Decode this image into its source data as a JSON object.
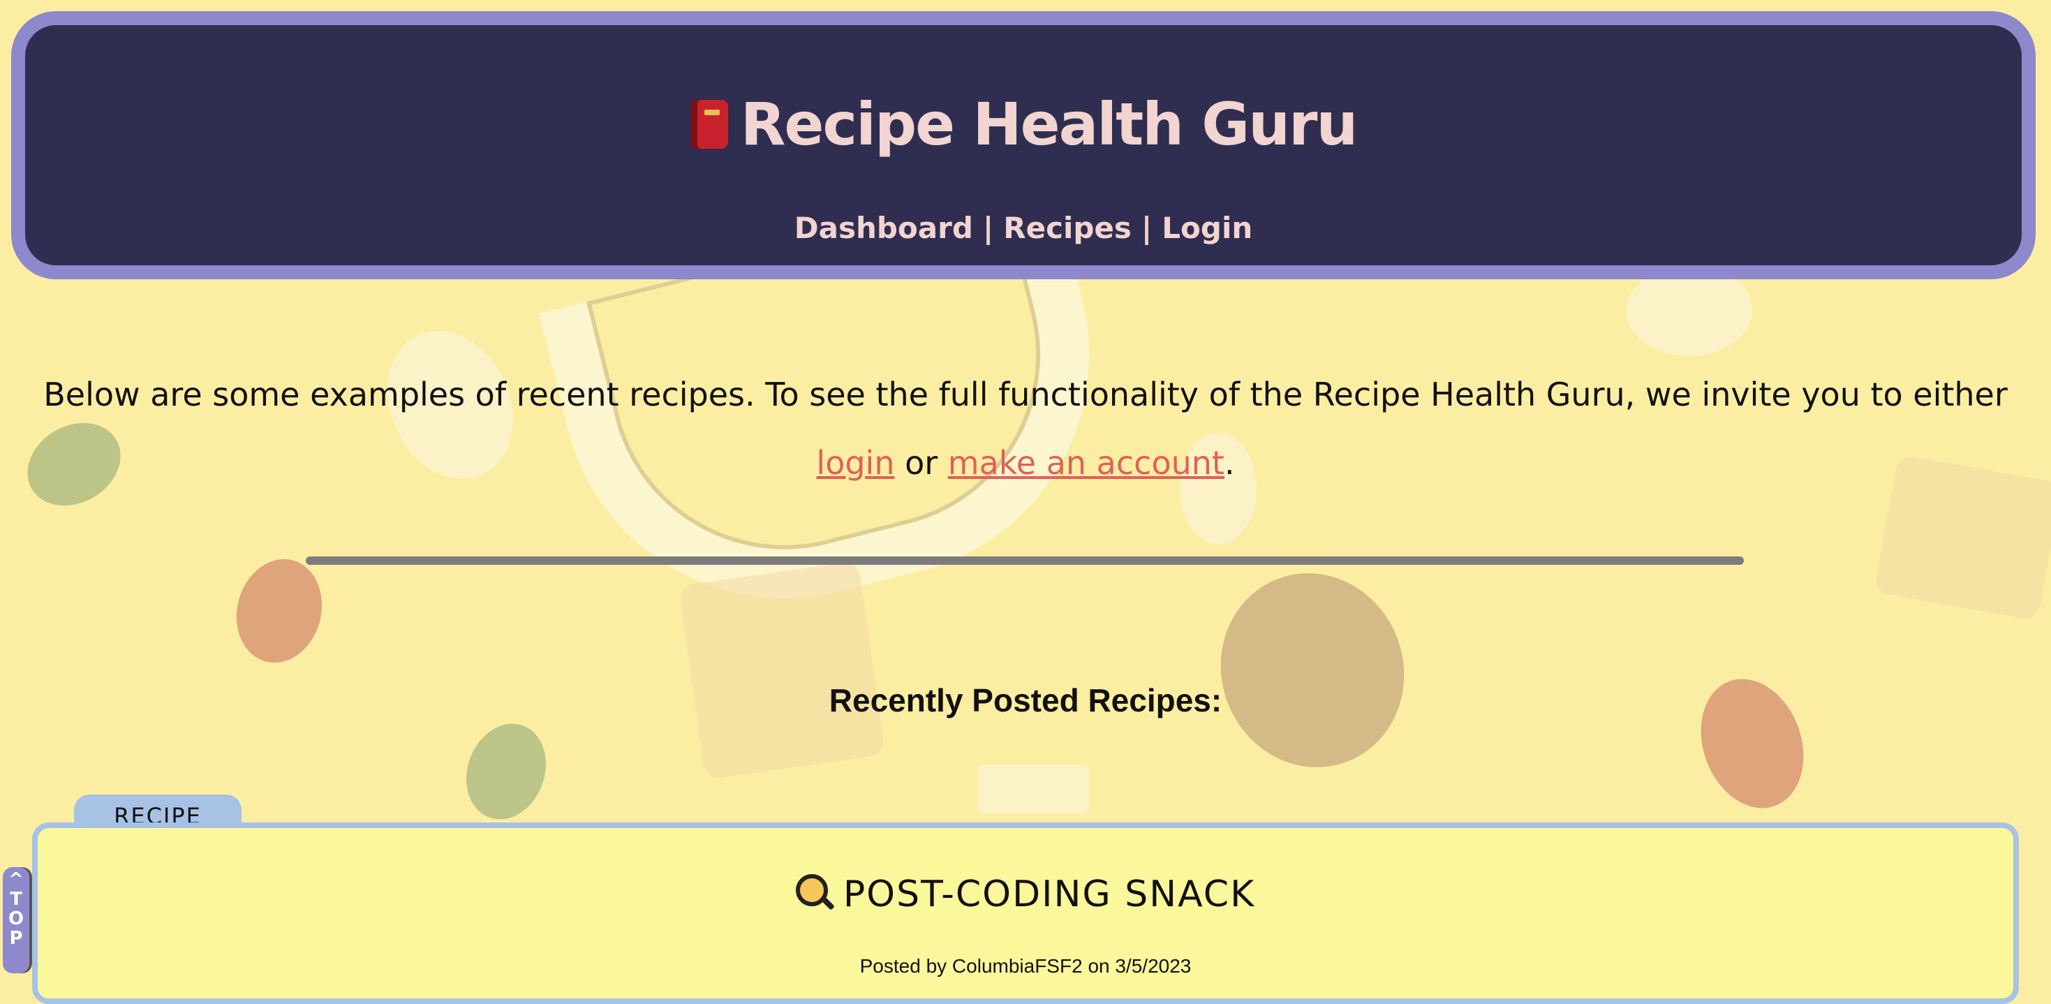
{
  "header": {
    "title": "Recipe Health Guru",
    "icon": "book-icon",
    "nav": [
      {
        "label": "Dashboard"
      },
      {
        "label": "Recipes"
      },
      {
        "label": "Login"
      }
    ],
    "separator": "|"
  },
  "intro": {
    "text_before": "Below are some examples of recent recipes. To see the full functionality of the Recipe Health Guru, we invite you to either ",
    "login_link": "login",
    "text_middle": " or ",
    "signup_link": "make an account",
    "text_after": "."
  },
  "recent": {
    "heading": "Recently Posted Recipes:"
  },
  "recipes": [
    {
      "tab_label": "RECIPE",
      "icon": "frying-pan-icon",
      "title": "POST-CODING SNACK",
      "meta": "Posted by ColumbiaFSF2 on 3/5/2023"
    }
  ],
  "back_to_top": {
    "arrow": "^",
    "letters": [
      "T",
      "O",
      "P"
    ]
  },
  "colors": {
    "header_bg": "#2f2e50",
    "header_border": "#8e88cc",
    "title_color": "#f2d4d0",
    "link_color": "#e0605a",
    "card_bg": "#fbf79b",
    "card_border": "#a7c2e4",
    "page_bg": "#fbeea2"
  }
}
